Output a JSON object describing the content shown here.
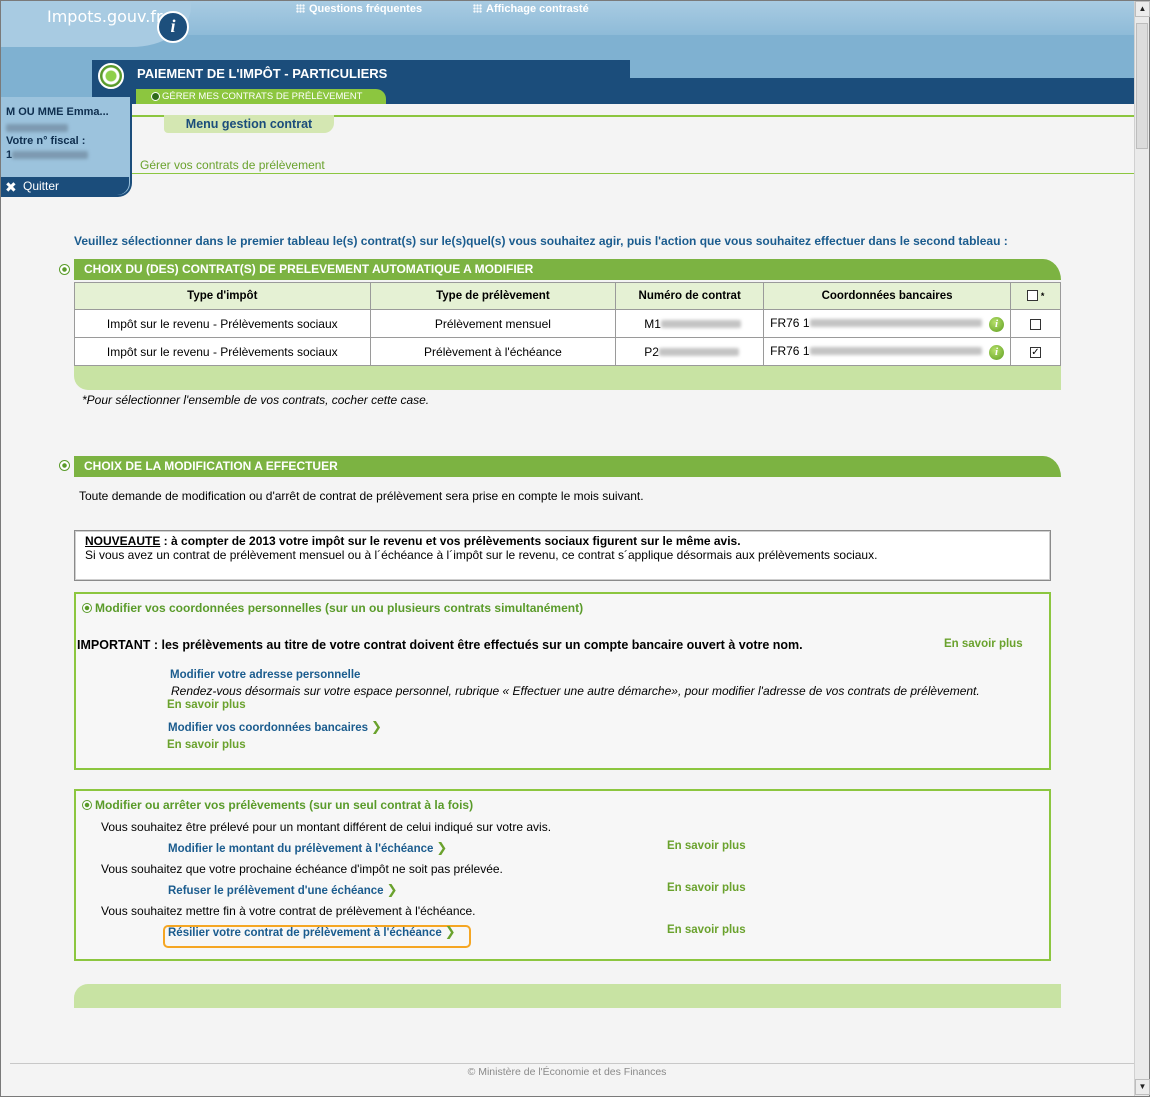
{
  "header": {
    "logo_text": "Impots.gouv.fr",
    "logo_badge": "i",
    "links": [
      "Questions fréquentes",
      "Affichage contrasté"
    ],
    "page_title": "PAIEMENT DE L'IMPÔT - PARTICULIERS",
    "subnav": "GÉRER MES CONTRATS DE PRÉLÈVEMENT"
  },
  "user": {
    "name": "M OU MME Emma...",
    "fiscal_label": "Votre n° fiscal :",
    "fiscal_prefix": "1",
    "quit": "Quitter"
  },
  "menu": {
    "tab": "Menu gestion contrat",
    "sub": "Gérer vos contrats de prélèvement"
  },
  "intro": "Veuillez sélectionner dans le premier tableau le(s) contrat(s) sur le(s)quel(s) vous souhaitez agir, puis l'action que vous souhaitez effectuer dans le second tableau :",
  "section1": {
    "title": "CHOIX DU (DES) CONTRAT(S) DE PRELEVEMENT AUTOMATIQUE A MODIFIER",
    "columns": [
      "Type d'impôt",
      "Type de prélèvement",
      "Numéro de contrat",
      "Coordonnées bancaires",
      "*"
    ],
    "rows": [
      {
        "type": "Impôt sur le revenu - Prélèvements sociaux",
        "mode": "Prélèvement mensuel",
        "contract_prefix": "M1",
        "iban_prefix": "FR76 1",
        "checked": false
      },
      {
        "type": "Impôt sur le revenu - Prélèvements sociaux",
        "mode": "Prélèvement à l'échéance",
        "contract_prefix": "P2",
        "iban_prefix": "FR76 1",
        "checked": true
      }
    ],
    "info_icon": "i",
    "check_mark": "✓",
    "note": "*Pour sélectionner l'ensemble de vos contrats, cocher cette case."
  },
  "section2": {
    "title": "CHOIX DE LA MODIFICATION A EFFECTUER",
    "notice": "Toute demande de modification ou d'arrêt de contrat de prélèvement sera prise en compte le mois suivant.",
    "nouveaute_label": "NOUVEAUTE",
    "nouveaute_text": " : à compter de 2013 votre impôt sur le revenu et vos prélèvements sociaux figurent sur le même avis.",
    "nouveaute_line2": "Si vous avez un contrat de prélèvement mensuel ou à l´échéance à l´impôt sur le revenu, ce contrat s´applique désormais aux prélèvements sociaux."
  },
  "box1": {
    "title": "Modifier vos coordonnées personnelles (sur un ou plusieurs contrats simultanément)",
    "important": "IMPORTANT : les prélèvements au titre de votre contrat doivent être effectués sur un compte bancaire ouvert à votre nom.",
    "learn_more": "En savoir plus",
    "link_address": "Modifier votre adresse personnelle",
    "address_text": "Rendez-vous désormais sur votre espace personnel, rubrique « Effectuer une autre démarche», pour modifier l'adresse de vos contrats de prélèvement.",
    "link_bank": "Modifier vos coordonnées bancaires"
  },
  "box2": {
    "title": "Modifier ou arrêter vos prélèvements (sur un seul contrat à la fois)",
    "learn_more": "En savoir plus",
    "items": [
      {
        "text": "Vous souhaitez être prélevé pour un montant différent de celui indiqué sur votre avis.",
        "link": "Modifier le montant du prélèvement à l'échéance"
      },
      {
        "text": "Vous souhaitez que votre prochaine échéance d'impôt ne soit pas prélevée.",
        "link": "Refuser le prélèvement d'une échéance"
      },
      {
        "text": "Vous souhaitez mettre fin à votre contrat de prélèvement à l'échéance.",
        "link": "Résilier votre contrat de prélèvement à l'échéance"
      }
    ]
  },
  "footer": "© Ministère de l'Économie et des Finances",
  "icons": {
    "chevron": "chevron-right-icon",
    "quit": "close-icon"
  }
}
